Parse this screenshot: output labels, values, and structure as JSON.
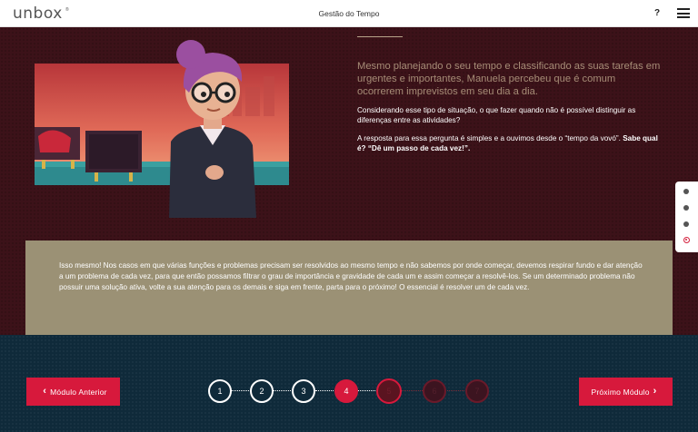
{
  "header": {
    "logo": "unbox",
    "logo_mark": "®",
    "title": "Gestão do Tempo",
    "help_label": "?"
  },
  "content": {
    "intro": "Mesmo planejando o seu tempo e classificando as suas tarefas em urgentes e importantes, Manuela percebeu que é comum ocorrerem imprevistos em seu dia a dia.",
    "question": "Considerando esse tipo de situação, o que fazer quando não é possível distinguir as diferenças entre as atividades?",
    "answer_prefix": "A resposta para essa pergunta é simples e a ouvimos desde o “tempo da vovó”. ",
    "answer_bold": "Sabe qual é? “Dê um passo de cada vez!”.",
    "info": "Isso mesmo! Nos casos em que várias funções e problemas precisam ser resolvidos ao mesmo tempo e não sabemos por onde começar, devemos respirar fundo e dar atenção a um problema de cada vez, para que então possamos filtrar o grau de importância e gravidade de cada um e assim começar a resolvê-los. Se um determinado problema não possuir uma solução ativa, volte a sua atenção para os demais e siga em frente, parta para o próximo! O essencial é resolver um de cada vez."
  },
  "side_nav": {
    "count": 4,
    "active_index": 3
  },
  "footer": {
    "prev_label": "Módulo Anterior",
    "next_label": "Próximo Módulo",
    "steps": [
      {
        "label": "1",
        "state": "done"
      },
      {
        "label": "2",
        "state": "done"
      },
      {
        "label": "3",
        "state": "done"
      },
      {
        "label": "4",
        "state": "current"
      },
      {
        "label": "5",
        "state": "next"
      },
      {
        "label": "6",
        "state": "locked"
      },
      {
        "label": "7",
        "state": "locked"
      }
    ]
  },
  "colors": {
    "accent": "#d7193c",
    "background": "#3c1219",
    "footer": "#0f2a3a",
    "info_box": "#9b9175",
    "intro_text": "#a78d77"
  },
  "icons": {
    "help": "question-icon",
    "menu": "hamburger-menu-icon",
    "prev": "chevron-left-icon",
    "next": "chevron-right-icon"
  }
}
